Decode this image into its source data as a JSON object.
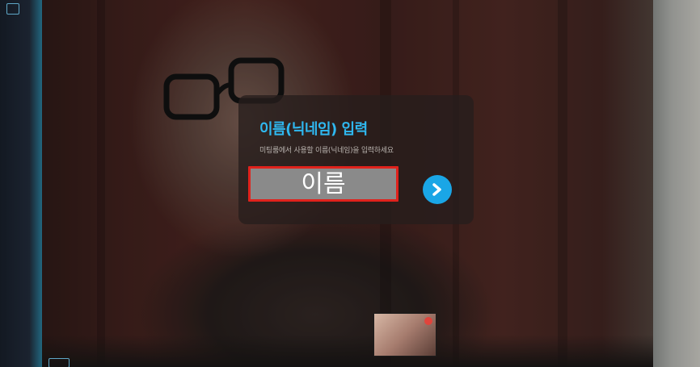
{
  "dialog": {
    "title": "이름(닉네임) 입력",
    "subtitle": "미팅룸에서 사용할 이름(닉네임)을 입력하세요",
    "name_field": {
      "placeholder": "이름",
      "value": ""
    },
    "next_button_icon": "chevron-right-icon"
  },
  "colors": {
    "accent": "#1aa6e6",
    "title": "#2fb8f0",
    "field_border": "#e0221c",
    "field_background": "#8a8a8a"
  }
}
